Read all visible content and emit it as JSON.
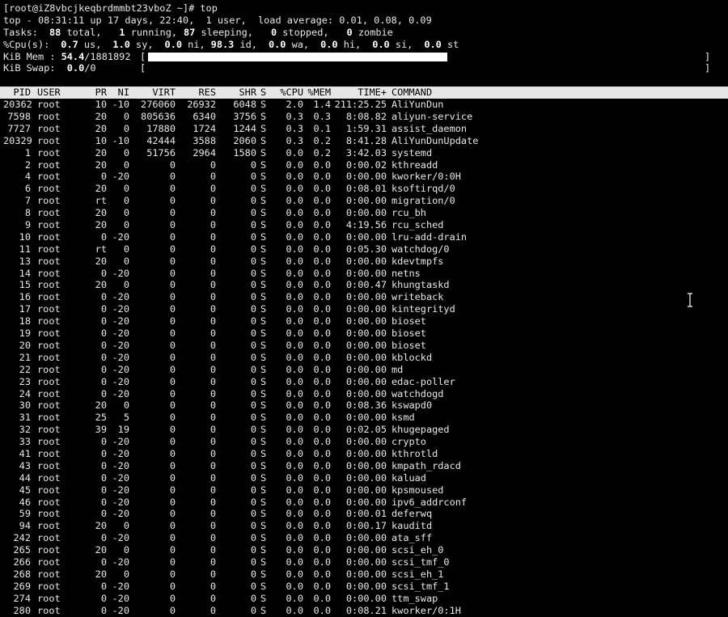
{
  "prompt": "[root@iZ8vbcjkeqbrdmmbt23vboZ ~]# top",
  "summary": {
    "uptime_line": "top - 08:31:11 up 17 days, 22:40,  1 user,  load average: 0.01, 0.08, 0.09",
    "tasks": {
      "label": "Tasks:",
      "total": "88",
      "total_label": " total,",
      "running": "1",
      "running_label": " running,",
      "sleeping": "87",
      "sleeping_label": " sleeping,",
      "stopped": "0",
      "stopped_label": " stopped,",
      "zombie": "0",
      "zombie_label": " zombie"
    },
    "cpu": {
      "label": "%Cpu(s):",
      "us": "0.7",
      "us_label": " us,",
      "sy": "1.0",
      "sy_label": " sy,",
      "ni": "0.0",
      "ni_label": " ni,",
      "id": "98.3",
      "id_label": " id,",
      "wa": "0.0",
      "wa_label": " wa,",
      "hi": "0.0",
      "hi_label": " hi,",
      "si": "0.0",
      "si_label": " si,",
      "st": "0.0",
      "st_label": " st"
    },
    "mem": {
      "label": "KiB Mem : ",
      "percent": "54.4",
      "total": "/1881892",
      "fill_fraction": 0.544
    },
    "swap": {
      "label": "KiB Swap:  ",
      "percent": "0.0",
      "total": "/0",
      "fill_fraction": 0.0
    }
  },
  "table": {
    "headers": {
      "pid": "PID",
      "user": "USER",
      "pr": "PR",
      "ni": "NI",
      "virt": "VIRT",
      "res": "RES",
      "shr": "SHR",
      "s": "S",
      "cpu": "%CPU",
      "mem": "%MEM",
      "time": "TIME+",
      "command": "COMMAND"
    },
    "rows": [
      {
        "pid": "20362",
        "user": "root",
        "pr": "10",
        "ni": "-10",
        "virt": "276060",
        "res": "26932",
        "shr": "6048",
        "s": "S",
        "cpu": "2.0",
        "mem": "1.4",
        "time": "211:25.25",
        "command": "AliYunDun"
      },
      {
        "pid": "7598",
        "user": "root",
        "pr": "20",
        "ni": "0",
        "virt": "805636",
        "res": "6340",
        "shr": "3756",
        "s": "S",
        "cpu": "0.3",
        "mem": "0.3",
        "time": "8:08.82",
        "command": "aliyun-service"
      },
      {
        "pid": "7727",
        "user": "root",
        "pr": "20",
        "ni": "0",
        "virt": "17880",
        "res": "1724",
        "shr": "1244",
        "s": "S",
        "cpu": "0.3",
        "mem": "0.1",
        "time": "1:59.31",
        "command": "assist_daemon"
      },
      {
        "pid": "20329",
        "user": "root",
        "pr": "10",
        "ni": "-10",
        "virt": "42444",
        "res": "3588",
        "shr": "2060",
        "s": "S",
        "cpu": "0.3",
        "mem": "0.2",
        "time": "8:41.28",
        "command": "AliYunDunUpdate"
      },
      {
        "pid": "1",
        "user": "root",
        "pr": "20",
        "ni": "0",
        "virt": "51756",
        "res": "2964",
        "shr": "1580",
        "s": "S",
        "cpu": "0.0",
        "mem": "0.2",
        "time": "3:42.03",
        "command": "systemd"
      },
      {
        "pid": "2",
        "user": "root",
        "pr": "20",
        "ni": "0",
        "virt": "0",
        "res": "0",
        "shr": "0",
        "s": "S",
        "cpu": "0.0",
        "mem": "0.0",
        "time": "0:00.02",
        "command": "kthreadd"
      },
      {
        "pid": "4",
        "user": "root",
        "pr": "0",
        "ni": "-20",
        "virt": "0",
        "res": "0",
        "shr": "0",
        "s": "S",
        "cpu": "0.0",
        "mem": "0.0",
        "time": "0:00.00",
        "command": "kworker/0:0H"
      },
      {
        "pid": "6",
        "user": "root",
        "pr": "20",
        "ni": "0",
        "virt": "0",
        "res": "0",
        "shr": "0",
        "s": "S",
        "cpu": "0.0",
        "mem": "0.0",
        "time": "0:08.01",
        "command": "ksoftirqd/0"
      },
      {
        "pid": "7",
        "user": "root",
        "pr": "rt",
        "ni": "0",
        "virt": "0",
        "res": "0",
        "shr": "0",
        "s": "S",
        "cpu": "0.0",
        "mem": "0.0",
        "time": "0:00.00",
        "command": "migration/0"
      },
      {
        "pid": "8",
        "user": "root",
        "pr": "20",
        "ni": "0",
        "virt": "0",
        "res": "0",
        "shr": "0",
        "s": "S",
        "cpu": "0.0",
        "mem": "0.0",
        "time": "0:00.00",
        "command": "rcu_bh"
      },
      {
        "pid": "9",
        "user": "root",
        "pr": "20",
        "ni": "0",
        "virt": "0",
        "res": "0",
        "shr": "0",
        "s": "S",
        "cpu": "0.0",
        "mem": "0.0",
        "time": "4:19.56",
        "command": "rcu_sched"
      },
      {
        "pid": "10",
        "user": "root",
        "pr": "0",
        "ni": "-20",
        "virt": "0",
        "res": "0",
        "shr": "0",
        "s": "S",
        "cpu": "0.0",
        "mem": "0.0",
        "time": "0:00.00",
        "command": "lru-add-drain"
      },
      {
        "pid": "11",
        "user": "root",
        "pr": "rt",
        "ni": "0",
        "virt": "0",
        "res": "0",
        "shr": "0",
        "s": "S",
        "cpu": "0.0",
        "mem": "0.0",
        "time": "0:05.30",
        "command": "watchdog/0"
      },
      {
        "pid": "13",
        "user": "root",
        "pr": "20",
        "ni": "0",
        "virt": "0",
        "res": "0",
        "shr": "0",
        "s": "S",
        "cpu": "0.0",
        "mem": "0.0",
        "time": "0:00.00",
        "command": "kdevtmpfs"
      },
      {
        "pid": "14",
        "user": "root",
        "pr": "0",
        "ni": "-20",
        "virt": "0",
        "res": "0",
        "shr": "0",
        "s": "S",
        "cpu": "0.0",
        "mem": "0.0",
        "time": "0:00.00",
        "command": "netns"
      },
      {
        "pid": "15",
        "user": "root",
        "pr": "20",
        "ni": "0",
        "virt": "0",
        "res": "0",
        "shr": "0",
        "s": "S",
        "cpu": "0.0",
        "mem": "0.0",
        "time": "0:00.47",
        "command": "khungtaskd"
      },
      {
        "pid": "16",
        "user": "root",
        "pr": "0",
        "ni": "-20",
        "virt": "0",
        "res": "0",
        "shr": "0",
        "s": "S",
        "cpu": "0.0",
        "mem": "0.0",
        "time": "0:00.00",
        "command": "writeback"
      },
      {
        "pid": "17",
        "user": "root",
        "pr": "0",
        "ni": "-20",
        "virt": "0",
        "res": "0",
        "shr": "0",
        "s": "S",
        "cpu": "0.0",
        "mem": "0.0",
        "time": "0:00.00",
        "command": "kintegrityd"
      },
      {
        "pid": "18",
        "user": "root",
        "pr": "0",
        "ni": "-20",
        "virt": "0",
        "res": "0",
        "shr": "0",
        "s": "S",
        "cpu": "0.0",
        "mem": "0.0",
        "time": "0:00.00",
        "command": "bioset"
      },
      {
        "pid": "19",
        "user": "root",
        "pr": "0",
        "ni": "-20",
        "virt": "0",
        "res": "0",
        "shr": "0",
        "s": "S",
        "cpu": "0.0",
        "mem": "0.0",
        "time": "0:00.00",
        "command": "bioset"
      },
      {
        "pid": "20",
        "user": "root",
        "pr": "0",
        "ni": "-20",
        "virt": "0",
        "res": "0",
        "shr": "0",
        "s": "S",
        "cpu": "0.0",
        "mem": "0.0",
        "time": "0:00.00",
        "command": "bioset"
      },
      {
        "pid": "21",
        "user": "root",
        "pr": "0",
        "ni": "-20",
        "virt": "0",
        "res": "0",
        "shr": "0",
        "s": "S",
        "cpu": "0.0",
        "mem": "0.0",
        "time": "0:00.00",
        "command": "kblockd"
      },
      {
        "pid": "22",
        "user": "root",
        "pr": "0",
        "ni": "-20",
        "virt": "0",
        "res": "0",
        "shr": "0",
        "s": "S",
        "cpu": "0.0",
        "mem": "0.0",
        "time": "0:00.00",
        "command": "md"
      },
      {
        "pid": "23",
        "user": "root",
        "pr": "0",
        "ni": "-20",
        "virt": "0",
        "res": "0",
        "shr": "0",
        "s": "S",
        "cpu": "0.0",
        "mem": "0.0",
        "time": "0:00.00",
        "command": "edac-poller"
      },
      {
        "pid": "24",
        "user": "root",
        "pr": "0",
        "ni": "-20",
        "virt": "0",
        "res": "0",
        "shr": "0",
        "s": "S",
        "cpu": "0.0",
        "mem": "0.0",
        "time": "0:00.00",
        "command": "watchdogd"
      },
      {
        "pid": "30",
        "user": "root",
        "pr": "20",
        "ni": "0",
        "virt": "0",
        "res": "0",
        "shr": "0",
        "s": "S",
        "cpu": "0.0",
        "mem": "0.0",
        "time": "0:08.36",
        "command": "kswapd0"
      },
      {
        "pid": "31",
        "user": "root",
        "pr": "25",
        "ni": "5",
        "virt": "0",
        "res": "0",
        "shr": "0",
        "s": "S",
        "cpu": "0.0",
        "mem": "0.0",
        "time": "0:00.00",
        "command": "ksmd"
      },
      {
        "pid": "32",
        "user": "root",
        "pr": "39",
        "ni": "19",
        "virt": "0",
        "res": "0",
        "shr": "0",
        "s": "S",
        "cpu": "0.0",
        "mem": "0.0",
        "time": "0:02.05",
        "command": "khugepaged"
      },
      {
        "pid": "33",
        "user": "root",
        "pr": "0",
        "ni": "-20",
        "virt": "0",
        "res": "0",
        "shr": "0",
        "s": "S",
        "cpu": "0.0",
        "mem": "0.0",
        "time": "0:00.00",
        "command": "crypto"
      },
      {
        "pid": "41",
        "user": "root",
        "pr": "0",
        "ni": "-20",
        "virt": "0",
        "res": "0",
        "shr": "0",
        "s": "S",
        "cpu": "0.0",
        "mem": "0.0",
        "time": "0:00.00",
        "command": "kthrotld"
      },
      {
        "pid": "43",
        "user": "root",
        "pr": "0",
        "ni": "-20",
        "virt": "0",
        "res": "0",
        "shr": "0",
        "s": "S",
        "cpu": "0.0",
        "mem": "0.0",
        "time": "0:00.00",
        "command": "kmpath_rdacd"
      },
      {
        "pid": "44",
        "user": "root",
        "pr": "0",
        "ni": "-20",
        "virt": "0",
        "res": "0",
        "shr": "0",
        "s": "S",
        "cpu": "0.0",
        "mem": "0.0",
        "time": "0:00.00",
        "command": "kaluad"
      },
      {
        "pid": "45",
        "user": "root",
        "pr": "0",
        "ni": "-20",
        "virt": "0",
        "res": "0",
        "shr": "0",
        "s": "S",
        "cpu": "0.0",
        "mem": "0.0",
        "time": "0:00.00",
        "command": "kpsmoused"
      },
      {
        "pid": "46",
        "user": "root",
        "pr": "0",
        "ni": "-20",
        "virt": "0",
        "res": "0",
        "shr": "0",
        "s": "S",
        "cpu": "0.0",
        "mem": "0.0",
        "time": "0:00.00",
        "command": "ipv6_addrconf"
      },
      {
        "pid": "59",
        "user": "root",
        "pr": "0",
        "ni": "-20",
        "virt": "0",
        "res": "0",
        "shr": "0",
        "s": "S",
        "cpu": "0.0",
        "mem": "0.0",
        "time": "0:00.01",
        "command": "deferwq"
      },
      {
        "pid": "94",
        "user": "root",
        "pr": "20",
        "ni": "0",
        "virt": "0",
        "res": "0",
        "shr": "0",
        "s": "S",
        "cpu": "0.0",
        "mem": "0.0",
        "time": "0:00.17",
        "command": "kauditd"
      },
      {
        "pid": "242",
        "user": "root",
        "pr": "0",
        "ni": "-20",
        "virt": "0",
        "res": "0",
        "shr": "0",
        "s": "S",
        "cpu": "0.0",
        "mem": "0.0",
        "time": "0:00.00",
        "command": "ata_sff"
      },
      {
        "pid": "265",
        "user": "root",
        "pr": "20",
        "ni": "0",
        "virt": "0",
        "res": "0",
        "shr": "0",
        "s": "S",
        "cpu": "0.0",
        "mem": "0.0",
        "time": "0:00.00",
        "command": "scsi_eh_0"
      },
      {
        "pid": "266",
        "user": "root",
        "pr": "0",
        "ni": "-20",
        "virt": "0",
        "res": "0",
        "shr": "0",
        "s": "S",
        "cpu": "0.0",
        "mem": "0.0",
        "time": "0:00.00",
        "command": "scsi_tmf_0"
      },
      {
        "pid": "268",
        "user": "root",
        "pr": "20",
        "ni": "0",
        "virt": "0",
        "res": "0",
        "shr": "0",
        "s": "S",
        "cpu": "0.0",
        "mem": "0.0",
        "time": "0:00.00",
        "command": "scsi_eh_1"
      },
      {
        "pid": "269",
        "user": "root",
        "pr": "0",
        "ni": "-20",
        "virt": "0",
        "res": "0",
        "shr": "0",
        "s": "S",
        "cpu": "0.0",
        "mem": "0.0",
        "time": "0:00.00",
        "command": "scsi_tmf_1"
      },
      {
        "pid": "274",
        "user": "root",
        "pr": "0",
        "ni": "-20",
        "virt": "0",
        "res": "0",
        "shr": "0",
        "s": "S",
        "cpu": "0.0",
        "mem": "0.0",
        "time": "0:00.00",
        "command": "ttm_swap"
      },
      {
        "pid": "280",
        "user": "root",
        "pr": "0",
        "ni": "-20",
        "virt": "0",
        "res": "0",
        "shr": "0",
        "s": "S",
        "cpu": "0.0",
        "mem": "0.0",
        "time": "0:08.21",
        "command": "kworker/0:1H"
      }
    ]
  },
  "cursor_icon": "i-beam-cursor-icon",
  "colors": {
    "background": "#000000",
    "foreground": "#e8e8e8",
    "header_bg": "#e6e6e6",
    "bar": "#ffffff"
  }
}
